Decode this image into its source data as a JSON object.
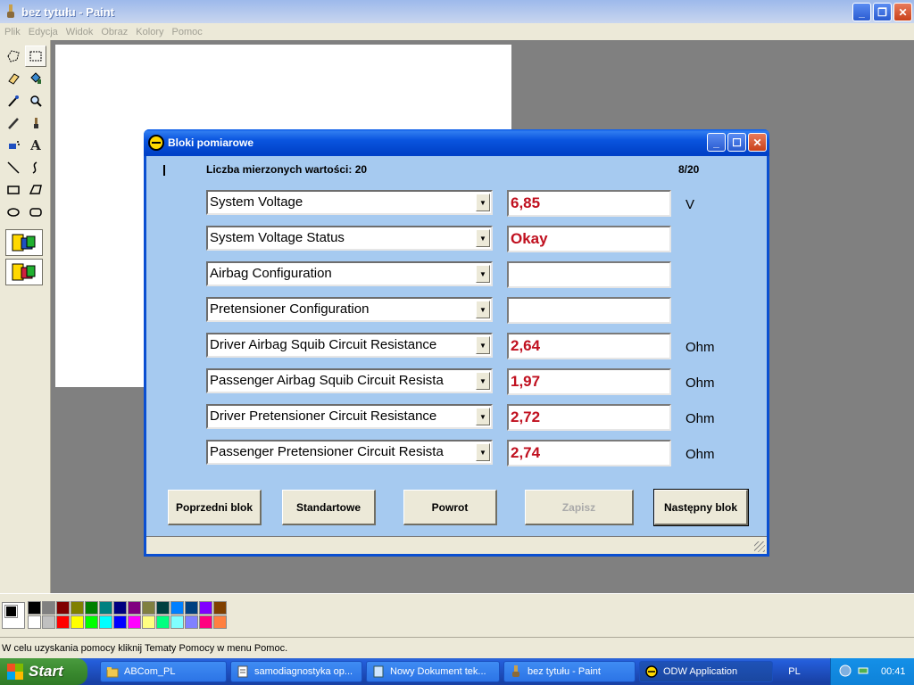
{
  "window": {
    "title": "bez tytułu - Paint",
    "minimize_glyph": "_",
    "maximize_glyph": "❐",
    "close_glyph": "✕"
  },
  "menu": [
    "Plik",
    "Edycja",
    "Widok",
    "Obraz",
    "Kolory",
    "Pomoc"
  ],
  "tools": [
    "free-select-icon",
    "rect-select-icon",
    "eraser-icon",
    "fill-bucket-icon",
    "color-picker-icon",
    "magnifier-icon",
    "pencil-icon",
    "brush-icon",
    "airbrush-icon",
    "text-icon",
    "line-icon",
    "curve-icon",
    "rectangle-icon",
    "polygon-icon",
    "ellipse-icon",
    "rounded-rect-icon"
  ],
  "palette": [
    "#000000",
    "#808080",
    "#800000",
    "#808000",
    "#008000",
    "#008080",
    "#000080",
    "#800080",
    "#808040",
    "#004040",
    "#0080ff",
    "#004080",
    "#8000ff",
    "#804000",
    "#ffffff",
    "#c0c0c0",
    "#ff0000",
    "#ffff00",
    "#00ff00",
    "#00ffff",
    "#0000ff",
    "#ff00ff",
    "#ffff80",
    "#00ff80",
    "#80ffff",
    "#8080ff",
    "#ff0080",
    "#ff8040"
  ],
  "statusbar": "W celu uzyskania pomocy kliknij Tematy Pomocy w menu Pomoc.",
  "dialog": {
    "title": "Bloki pomiarowe",
    "count_label": "Liczba mierzonych wartości: 20",
    "page": "8/20",
    "rows": [
      {
        "label": "System Voltage",
        "value": "6,85",
        "unit": "V"
      },
      {
        "label": "System Voltage Status",
        "value": "Okay",
        "unit": ""
      },
      {
        "label": "Airbag Configuration",
        "value": "",
        "unit": ""
      },
      {
        "label": "Pretensioner Configuration",
        "value": "",
        "unit": ""
      },
      {
        "label": "Driver Airbag Squib Circuit Resistance",
        "value": "2,64",
        "unit": "Ohm"
      },
      {
        "label": "Passenger Airbag Squib Circuit Resista",
        "value": "1,97",
        "unit": "Ohm"
      },
      {
        "label": "Driver Pretensioner Circuit Resistance",
        "value": "2,72",
        "unit": "Ohm"
      },
      {
        "label": "Passenger Pretensioner Circuit Resista",
        "value": "2,74",
        "unit": "Ohm"
      }
    ],
    "buttons": {
      "prev": "Poprzedni blok",
      "standard": "Standartowe",
      "back": "Powrot",
      "save": "Zapisz",
      "next": "Następny blok"
    }
  },
  "taskbar": {
    "start": "Start",
    "items": [
      {
        "label": "ABCom_PL"
      },
      {
        "label": "samodiagnostyka op..."
      },
      {
        "label": "Nowy Dokument tek..."
      },
      {
        "label": "bez tytułu - Paint"
      },
      {
        "label": "ODW Application"
      }
    ],
    "lang": "PL",
    "clock": "00:41"
  },
  "colors": {
    "value_red": "#c0101f",
    "dialog_bg": "#A6CAF0",
    "xp_blue": "#0a55df"
  }
}
